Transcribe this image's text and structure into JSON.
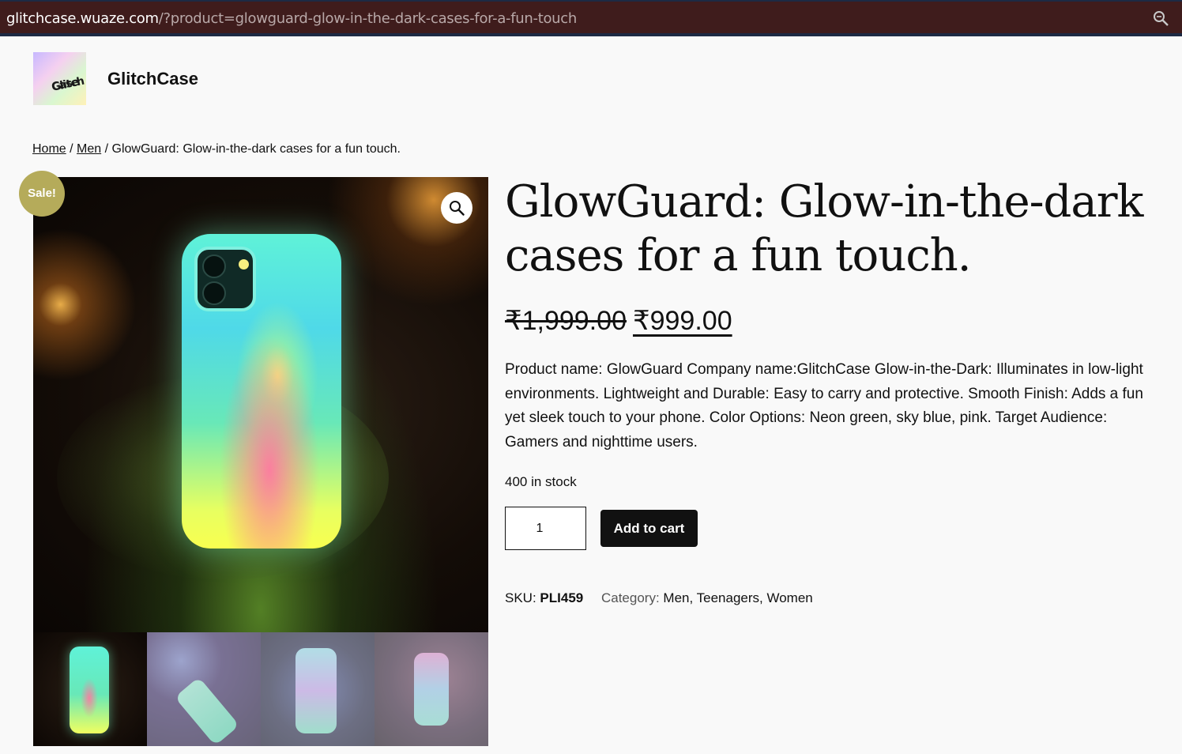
{
  "browser": {
    "url_host": "glitchcase.wuaze.com",
    "url_path": "/?product=glowguard-glow-in-the-dark-cases-for-a-fun-touch",
    "zoom_icon": "zoom-icon"
  },
  "header": {
    "logo_text_line1": "Glitch",
    "logo_text_line2": "Case",
    "site_title": "GlitchCase"
  },
  "breadcrumb": {
    "home": "Home",
    "sep1": " / ",
    "category": "Men",
    "sep2": " / ",
    "current": "GlowGuard: Glow-in-the-dark cases for a fun touch."
  },
  "gallery": {
    "sale_badge": "Sale!",
    "zoom_icon": "magnifier-icon",
    "thumbnail_count": 4
  },
  "product": {
    "title": "GlowGuard: Glow-in-the-dark cases for a fun touch.",
    "regular_price": "₹1,999.00",
    "sale_price": "₹999.00",
    "description": "Product name: GlowGuard Company name:GlitchCase Glow-in-the-Dark: Illuminates in low-light environments. Lightweight and Durable: Easy to carry and protective. Smooth Finish: Adds a fun yet sleek touch to your phone. Color Options: Neon green, sky blue, pink. Target Audience: Gamers and nighttime users.",
    "stock": "400 in stock",
    "quantity": "1",
    "add_to_cart_label": "Add to cart",
    "sku_label": "SKU:",
    "sku_value": "PLI459",
    "category_label": "Category:",
    "categories": [
      "Men",
      "Teenagers",
      "Women"
    ]
  },
  "colors": {
    "urlbar_bg": "#3f1c1c",
    "sale_badge_bg": "#b5ab5a",
    "button_bg": "#111111",
    "page_bg": "#f9f9f9"
  }
}
